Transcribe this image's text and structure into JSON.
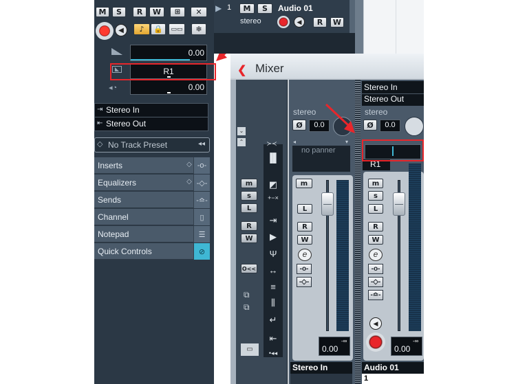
{
  "inspector": {
    "tool_buttons": [
      "M",
      "S",
      "R",
      "W"
    ],
    "volume_value": "0.00",
    "routing_value": "R1",
    "pan_value": "0.00",
    "input": "Stereo In",
    "output": "Stereo Out",
    "track_preset": "No Track Preset",
    "sections": [
      {
        "label": "Inserts"
      },
      {
        "label": "Equalizers"
      },
      {
        "label": "Sends"
      },
      {
        "label": "Channel"
      },
      {
        "label": "Notepad"
      },
      {
        "label": "Quick Controls"
      }
    ]
  },
  "track": {
    "number": "1",
    "mute": "M",
    "solo": "S",
    "name": "Audio 01",
    "type": "stereo",
    "read": "R",
    "write": "W"
  },
  "mixer": {
    "title": "Mixer",
    "strip_left": {
      "label": "stereo",
      "phase_value": "0.0",
      "panner": "no panner",
      "buttons": [
        "m",
        "L",
        "R",
        "W"
      ],
      "fader_value": "0.00",
      "meter_peak": "-∞",
      "name": "Stereo In"
    },
    "strip_right": {
      "input": "Stereo In",
      "output": "Stereo Out",
      "label": "stereo",
      "phase_value": "0.0",
      "routing": "R1",
      "buttons": [
        "m",
        "s",
        "L",
        "R",
        "W"
      ],
      "fader_value": "0.00",
      "meter_peak": "-∞",
      "name": "Audio 01",
      "number": "1"
    },
    "side_buttons": [
      "m",
      "s",
      "L",
      "R",
      "W"
    ],
    "side_misc": "O<<"
  },
  "colors": {
    "inspector_bg": "#2b3845",
    "highlight_red": "#e8262b",
    "arrow_red": "#e8262b",
    "accent_cyan": "#3fb7d4"
  }
}
